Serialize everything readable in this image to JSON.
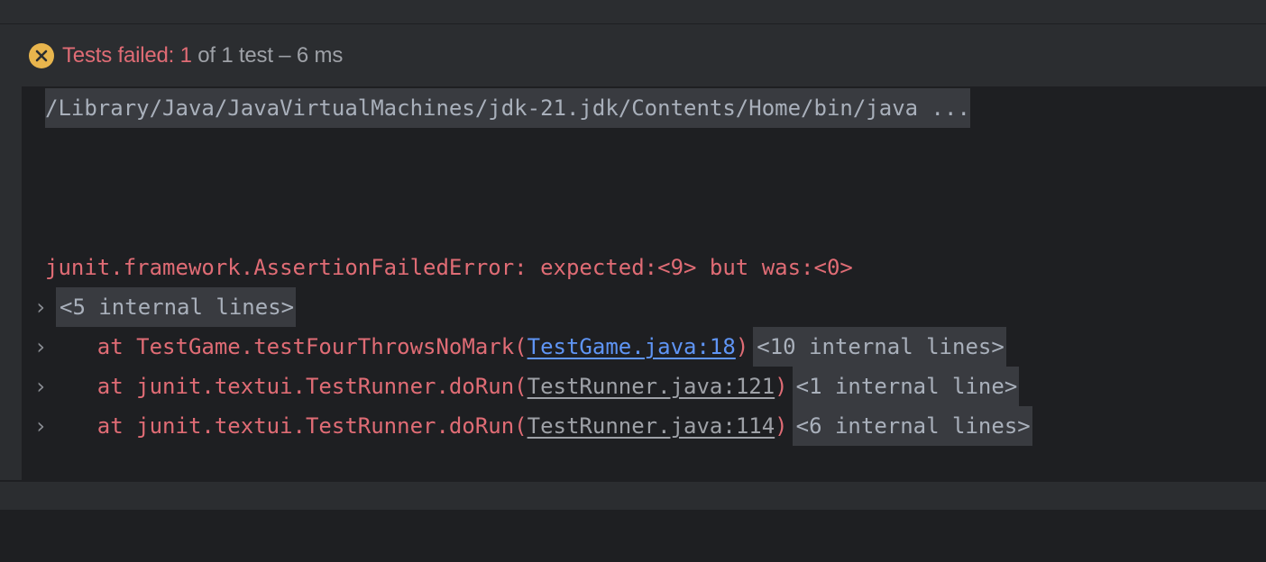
{
  "status": {
    "icon": "fail-circle-x-icon",
    "prefix": "Tests failed: ",
    "failed_count": "1",
    "middle": " of 1 test – ",
    "duration": "6 ms",
    "colors": {
      "red": "#e06c75",
      "grey": "#9ea1a7",
      "icon": "#e8b54d"
    }
  },
  "console": {
    "command": "/Library/Java/JavaVirtualMachines/jdk-21.jdk/Contents/Home/bin/java ...",
    "error": "junit.framework.AssertionFailedError: expected:<9> but was:<0>",
    "fold_first": "<5 internal lines>",
    "stack": [
      {
        "prefix": "    at TestGame.testFourThrowsNoMark(",
        "link": "TestGame.java:18",
        "suffix": ")",
        "fold": "<10 internal lines>",
        "link_style": "blue"
      },
      {
        "prefix": "    at junit.textui.TestRunner.doRun(",
        "link": "TestRunner.java:121",
        "suffix": ")",
        "fold": "<1 internal line>",
        "link_style": "grey"
      },
      {
        "prefix": "    at junit.textui.TestRunner.doRun(",
        "link": "TestRunner.java:114",
        "suffix": ")",
        "fold": "<6 internal lines>",
        "link_style": "grey"
      }
    ],
    "chevron": "›"
  }
}
